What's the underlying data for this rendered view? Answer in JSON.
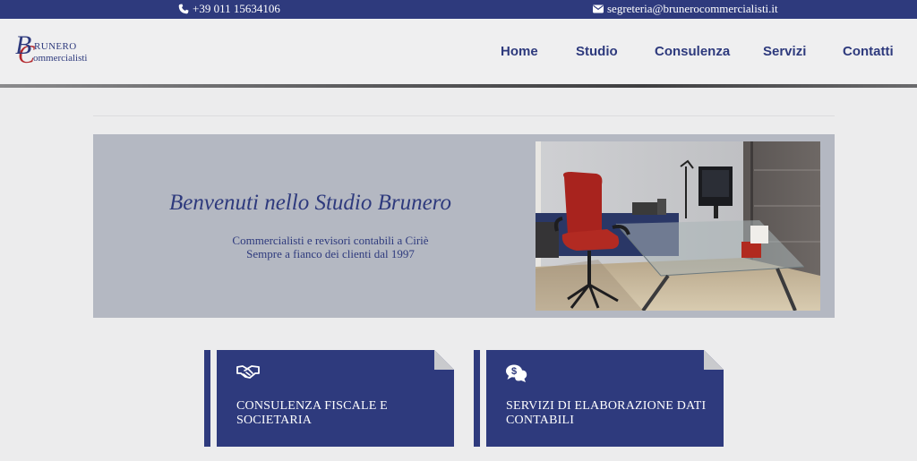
{
  "topbar": {
    "phone": "+39 011 15634106",
    "email": "segreteria@brunerocommercialisti.it"
  },
  "logo": {
    "initial_b": "B",
    "initial_c": "C",
    "word_1": "RUNERO",
    "word_2": "ommercialisti"
  },
  "nav": {
    "items": [
      "Home",
      "Studio",
      "Consulenza",
      "Servizi",
      "Contatti"
    ]
  },
  "hero": {
    "title": "Benvenuti nello Studio Brunero",
    "subtitle_line1": "Commercialisti e revisori contabili a Ciriè",
    "subtitle_line2": "Sempre a fianco dei clienti dal 1997"
  },
  "cards": [
    {
      "label": "CONSULENZA FISCALE E SOCIETARIA",
      "icon": "handshake-icon"
    },
    {
      "label": "SERVIZI DI ELABORAZIONE DATI CONTABILI",
      "icon": "chat-dollar-icon"
    }
  ],
  "colors": {
    "brand_blue": "#2e3a7d",
    "brand_red": "#b3282d",
    "hero_bg": "#b4b8c2",
    "page_bg": "#ececed"
  }
}
